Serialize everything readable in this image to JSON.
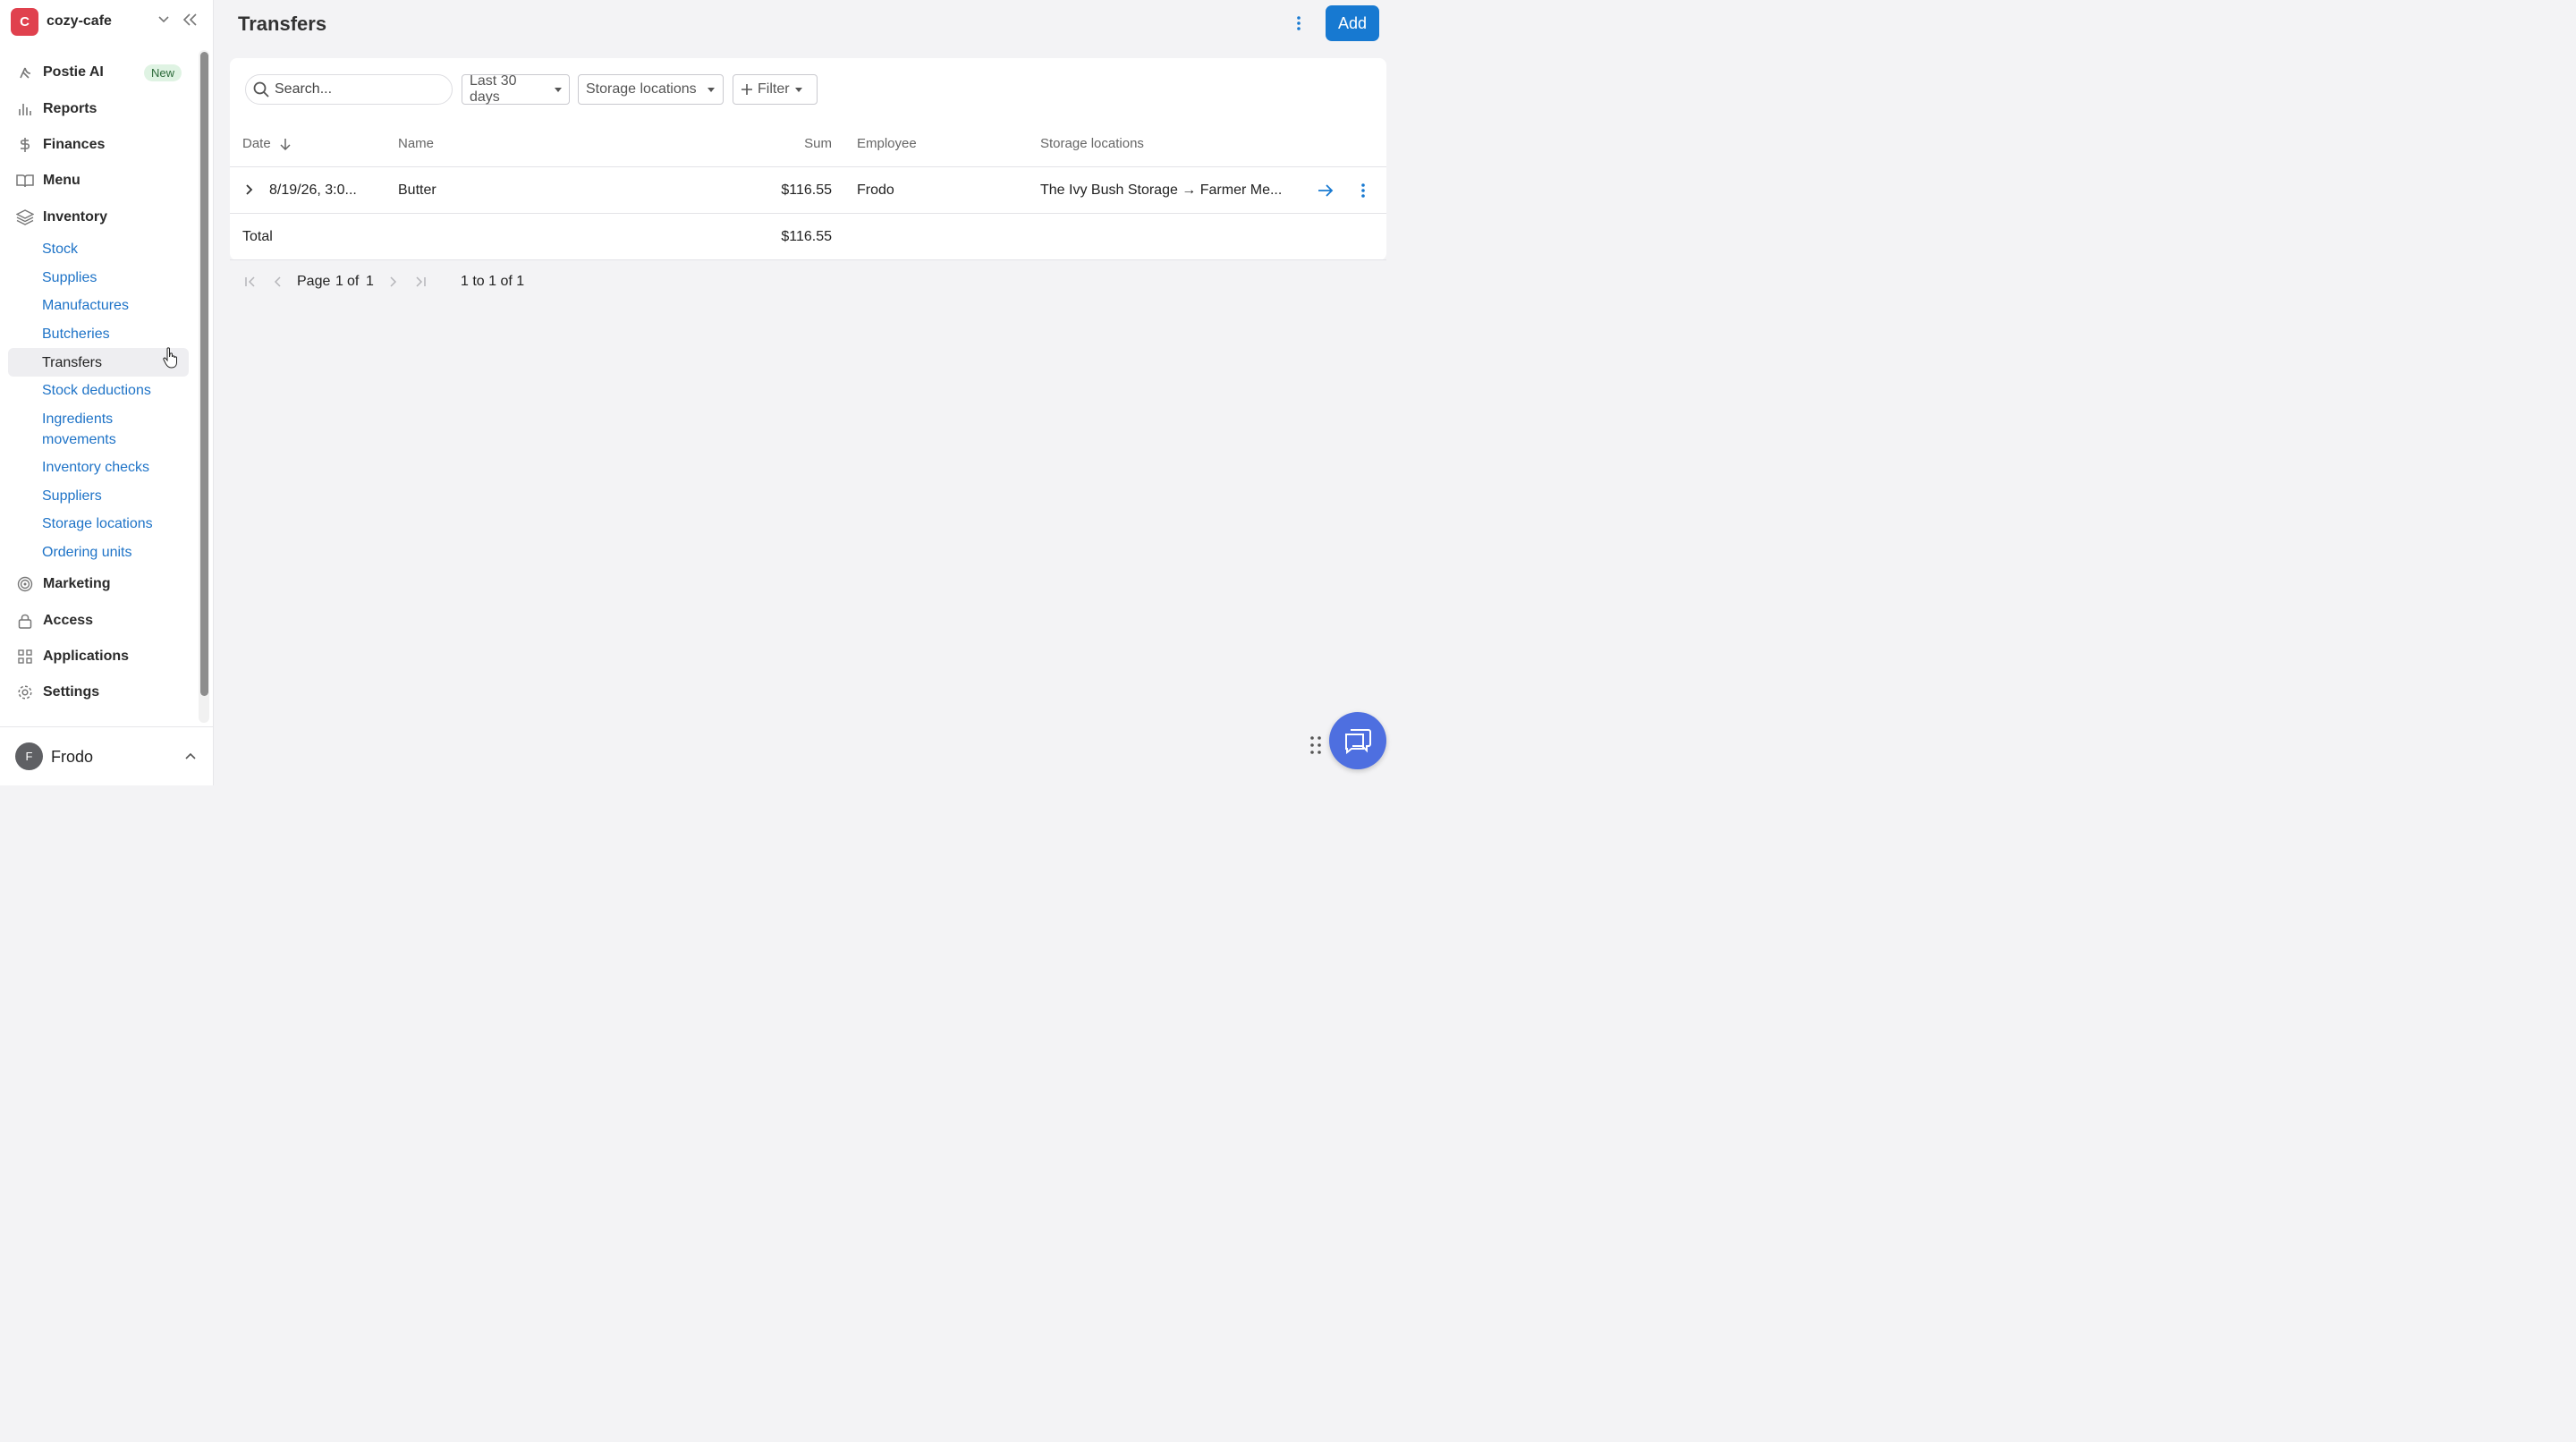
{
  "account": {
    "initial": "C",
    "name": "cozy-cafe"
  },
  "sidebar": {
    "items": [
      {
        "label": "Postie AI",
        "badge": "New",
        "icon": "sparkle-icon"
      },
      {
        "label": "Reports",
        "icon": "bar-chart-icon"
      },
      {
        "label": "Finances",
        "icon": "dollar-icon"
      },
      {
        "label": "Menu",
        "icon": "book-icon"
      },
      {
        "label": "Inventory",
        "icon": "layers-icon"
      }
    ],
    "inventory_sub": [
      "Stock",
      "Supplies",
      "Manufactures",
      "Butcheries",
      "Transfers",
      "Stock deductions",
      "Ingredients movements",
      "Inventory checks",
      "Suppliers",
      "Storage locations",
      "Ordering units"
    ],
    "items_bottom": [
      {
        "label": "Marketing",
        "icon": "target-icon"
      },
      {
        "label": "Access",
        "icon": "lock-icon"
      },
      {
        "label": "Applications",
        "icon": "grid-icon"
      },
      {
        "label": "Settings",
        "icon": "gear-icon"
      }
    ]
  },
  "user": {
    "initial": "F",
    "name": "Frodo"
  },
  "page": {
    "title": "Transfers",
    "add_label": "Add"
  },
  "filters": {
    "search_placeholder": "Search...",
    "date_range": "Last 30 days",
    "storage": "Storage locations",
    "filter": "Filter"
  },
  "table": {
    "headers": {
      "date": "Date",
      "name": "Name",
      "sum": "Sum",
      "employee": "Employee",
      "storage": "Storage locations"
    },
    "rows": [
      {
        "date": "8/19/26, 3:0...",
        "name": "Butter",
        "sum": "$116.55",
        "employee": "Frodo",
        "storage": "The Ivy Bush Storage → Farmer Me..."
      }
    ],
    "total_label": "Total",
    "total_sum": "$116.55"
  },
  "pagination": {
    "page_label": "Page",
    "page": "1",
    "of_label": "of",
    "pages": "1",
    "range": "1 to 1 of 1"
  },
  "colors": {
    "accent": "#1779d1",
    "badge": "#e0414e",
    "link": "#1e73c7",
    "chat": "#4e6fe0"
  }
}
